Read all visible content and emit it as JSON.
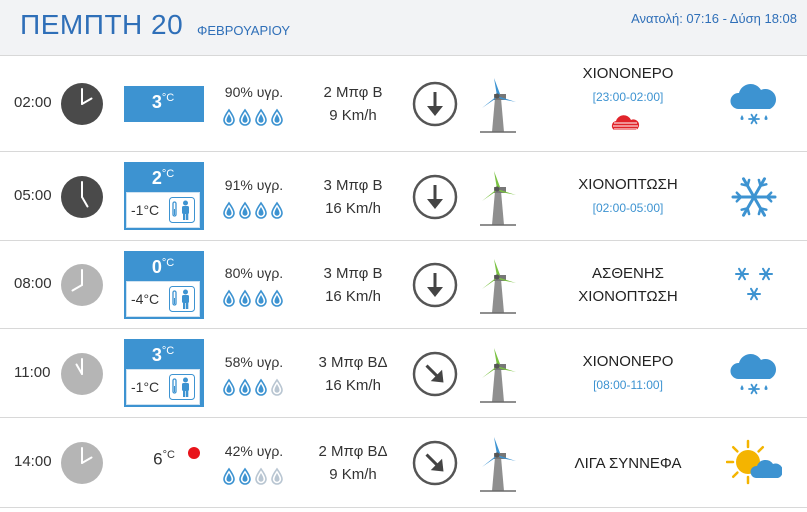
{
  "header": {
    "day": "ΠΕΜΠΤΗ 20",
    "month": "ΦΕΒΡΟΥΑΡΙΟΥ",
    "sunrise_sunset": "Ανατολή: 07:16  - Δύση 18:08"
  },
  "units": {
    "celsius": "°C"
  },
  "colors": {
    "accent": "#3d93d1",
    "title": "#2f6fb8",
    "clock_dark": "#4a4a4a",
    "clock_light": "#b5b5b5",
    "turbine_blue": "#3d93d1",
    "turbine_green": "#7ac142",
    "alert_red": "#e8141b"
  },
  "rows": [
    {
      "time": "02:00",
      "clock": "dark",
      "hour": 2,
      "temp": "3",
      "feels_like": "",
      "highlight": true,
      "humidity": "90% υγρ.",
      "drops_filled": 4,
      "wind_force": "2 Μπφ Β",
      "wind_speed": "9 Km/h",
      "direction": "down",
      "turbine": "blue",
      "desc_1": "ΧΙΟΝΟΝΕΡΟ",
      "desc_2": "",
      "range": "[23:00-02:00]",
      "fog_icon": true,
      "weather_icon": "cloud-sleet-icon"
    },
    {
      "time": "05:00",
      "clock": "dark",
      "hour": 5,
      "temp": "2",
      "feels_like": "-1°C",
      "highlight": true,
      "humidity": "91% υγρ.",
      "drops_filled": 4,
      "wind_force": "3 Μπφ Β",
      "wind_speed": "16 Km/h",
      "direction": "down",
      "turbine": "green",
      "desc_1": "ΧΙΟΝΟΠΤΩΣΗ",
      "desc_2": "",
      "range": "[02:00-05:00]",
      "fog_icon": false,
      "weather_icon": "snowflake-icon"
    },
    {
      "time": "08:00",
      "clock": "light",
      "hour": 8,
      "temp": "0",
      "feels_like": "-4°C",
      "highlight": true,
      "humidity": "80% υγρ.",
      "drops_filled": 4,
      "wind_force": "3 Μπφ Β",
      "wind_speed": "16 Km/h",
      "direction": "down",
      "turbine": "green",
      "desc_1": "ΑΣΘΕΝΗΣ",
      "desc_2": "ΧΙΟΝΟΠΤΩΣΗ",
      "range": "",
      "fog_icon": false,
      "weather_icon": "light-snow-icon"
    },
    {
      "time": "11:00",
      "clock": "light",
      "hour": 11,
      "temp": "3",
      "feels_like": "-1°C",
      "highlight": true,
      "humidity": "58% υγρ.",
      "drops_filled": 3,
      "wind_force": "3 Μπφ ΒΔ",
      "wind_speed": "16 Km/h",
      "direction": "down-right",
      "turbine": "green",
      "desc_1": "ΧΙΟΝΟΝΕΡΟ",
      "desc_2": "",
      "range": "[08:00-11:00]",
      "fog_icon": false,
      "weather_icon": "cloud-sleet-icon"
    },
    {
      "time": "14:00",
      "clock": "light",
      "hour": 14,
      "temp": "6",
      "feels_like": "",
      "highlight": false,
      "humidity": "42% υγρ.",
      "drops_filled": 2,
      "wind_force": "2 Μπφ ΒΔ",
      "wind_speed": "9 Km/h",
      "direction": "down-right",
      "turbine": "blue",
      "desc_1": "ΛΙΓΑ ΣΥΝΝΕΦΑ",
      "desc_2": "",
      "range": "",
      "fog_icon": false,
      "weather_icon": "sun-cloud-icon"
    }
  ]
}
